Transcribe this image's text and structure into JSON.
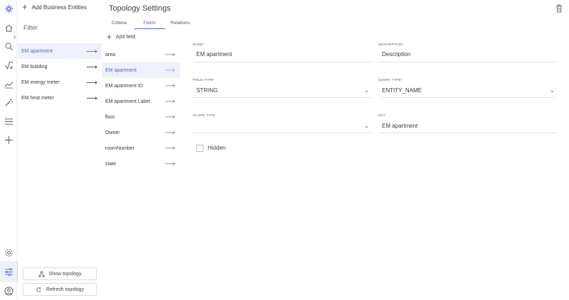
{
  "rail": {
    "icons": [
      "logo-icon",
      "home-icon",
      "search-icon",
      "formula-icon",
      "trend-icon",
      "magic-icon",
      "menu-icon",
      "add-icon",
      "settings-icon",
      "filters-icon",
      "user-icon"
    ]
  },
  "entity_panel": {
    "add_label": "Add Business Entities",
    "filter_label": "Filter",
    "items": [
      {
        "label": "EM apartment",
        "active": true
      },
      {
        "label": "EM building",
        "active": false
      },
      {
        "label": "EM energy meter",
        "active": false
      },
      {
        "label": "EM heat meter",
        "active": false
      }
    ],
    "show_topology": "Show topology",
    "refresh_topology": "Refresh topology"
  },
  "main": {
    "title": "Topology Settings",
    "tabs": [
      "Criteria",
      "Fields",
      "Relations"
    ],
    "active_tab": "Fields",
    "add_field_label": "Add field",
    "fields": [
      {
        "label": "area",
        "active": false
      },
      {
        "label": "EM apartment",
        "active": true
      },
      {
        "label": "EM apartment ID",
        "active": false
      },
      {
        "label": "EM apartment Label",
        "active": false
      },
      {
        "label": "floor",
        "active": false
      },
      {
        "label": "Owner",
        "active": false
      },
      {
        "label": "roomNumber",
        "active": false
      },
      {
        "label": "state",
        "active": false
      }
    ]
  },
  "form": {
    "name_label": "NAME*",
    "name_value": "EM apartment",
    "description_label": "DESCRIPTION",
    "description_value": "Description",
    "field_type_label": "FIELD TYPE*",
    "field_type_value": "STRING",
    "query_type_label": "QUERY TYPE*",
    "query_type_value": "ENTITY_NAME",
    "scope_type_label": "SCOPE TYPE",
    "scope_type_value": "",
    "key_label": "KEY",
    "key_value": "EM apartment",
    "hidden_label": "Hidden"
  },
  "colors": {
    "accent": "#5563d6",
    "active_bg": "#eef0fb",
    "border": "#e4e4e4"
  }
}
